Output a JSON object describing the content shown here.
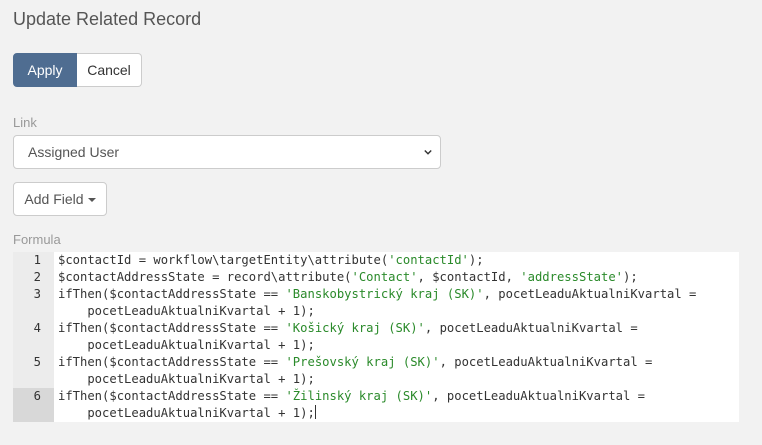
{
  "header": {
    "title": "Update Related Record"
  },
  "actions": {
    "apply_label": "Apply",
    "cancel_label": "Cancel"
  },
  "link": {
    "label": "Link",
    "selected": "Assigned User",
    "icon": "chevron-down-icon"
  },
  "add_field": {
    "label": "Add Field"
  },
  "formula": {
    "label": "Formula",
    "active_line": 6,
    "lines": [
      {
        "num": "1",
        "rows": [
          [
            {
              "t": "$contactId = workflow\\targetEntity\\attribute("
            },
            {
              "t": "'contactId'",
              "s": 1
            },
            {
              "t": ");"
            }
          ]
        ]
      },
      {
        "num": "2",
        "rows": [
          [
            {
              "t": "$contactAddressState = record\\attribute("
            },
            {
              "t": "'Contact'",
              "s": 1
            },
            {
              "t": ", $contactId, "
            },
            {
              "t": "'addressState'",
              "s": 1
            },
            {
              "t": ");"
            }
          ]
        ]
      },
      {
        "num": "3",
        "rows": [
          [
            {
              "t": "ifThen($contactAddressState == "
            },
            {
              "t": "'Banskobystrický kraj (SK)'",
              "s": 1
            },
            {
              "t": ", pocetLeaduAktualniKvartal ="
            }
          ],
          [
            {
              "t": "    pocetLeaduAktualniKvartal + 1);"
            }
          ]
        ]
      },
      {
        "num": "4",
        "rows": [
          [
            {
              "t": "ifThen($contactAddressState == "
            },
            {
              "t": "'Košický kraj (SK)'",
              "s": 1
            },
            {
              "t": ", pocetLeaduAktualniKvartal ="
            }
          ],
          [
            {
              "t": "    pocetLeaduAktualniKvartal + 1);"
            }
          ]
        ]
      },
      {
        "num": "5",
        "rows": [
          [
            {
              "t": "ifThen($contactAddressState == "
            },
            {
              "t": "'Prešovský kraj (SK)'",
              "s": 1
            },
            {
              "t": ", pocetLeaduAktualniKvartal ="
            }
          ],
          [
            {
              "t": "    pocetLeaduAktualniKvartal + 1);"
            }
          ]
        ]
      },
      {
        "num": "6",
        "rows": [
          [
            {
              "t": "ifThen($contactAddressState == "
            },
            {
              "t": "'Žilinský kraj (SK)'",
              "s": 1
            },
            {
              "t": ", pocetLeaduAktualniKvartal ="
            }
          ],
          [
            {
              "t": "    pocetLeaduAktualniKvartal + 1);"
            }
          ]
        ]
      }
    ]
  },
  "colors": {
    "primary": "#4f6d91",
    "string": "#2a8a2a",
    "background": "#f2f2f2"
  }
}
